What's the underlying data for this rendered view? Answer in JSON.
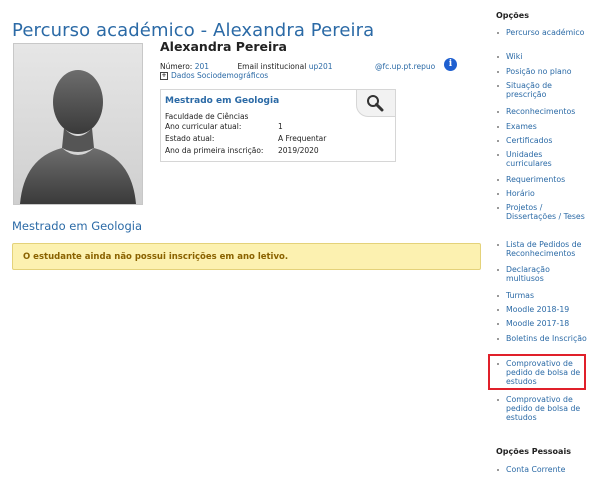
{
  "header": {
    "title": "Percurso académico - Alexandra Pereira"
  },
  "student": {
    "name": "Alexandra Pereira",
    "number_label": "Número:",
    "number_value": "201",
    "email_label": "Email institucional",
    "email_user": "up201",
    "email_domain": "@fc.up.pt.repuo",
    "socio_link": "Dados Sociodemográficos",
    "socio_toggle": "+"
  },
  "course_card": {
    "title": "Mestrado em Geologia",
    "rows": [
      {
        "key": "Faculdade de Ciências",
        "value": ""
      },
      {
        "key": "Ano curricular atual:",
        "value": "1"
      },
      {
        "key": "Estado atual:",
        "value": "A Frequentar"
      },
      {
        "key": "Ano da primeira inscrição:",
        "value": "2019/2020"
      }
    ]
  },
  "section": {
    "title": "Mestrado em Geologia",
    "warning": "O estudante ainda não possui inscrições em ano letivo."
  },
  "sidebar": {
    "options_title": "Opções",
    "items": [
      {
        "label": "Percurso académico"
      },
      {
        "label": "Wiki"
      },
      {
        "label": "Posição no plano"
      },
      {
        "label": "Situação de prescrição"
      },
      {
        "label": "Reconhecimentos"
      },
      {
        "label": "Exames"
      },
      {
        "label": "Certificados"
      },
      {
        "label": "Unidades curriculares"
      },
      {
        "label": "Requerimentos"
      },
      {
        "label": "Horário"
      },
      {
        "label": "Projetos / Dissertações / Teses"
      },
      {
        "label": "Lista de Pedidos de Reconhecimentos"
      },
      {
        "label": "Declaração multiusos"
      },
      {
        "label": "Turmas"
      },
      {
        "label": "Moodle 2018-19"
      },
      {
        "label": "Moodle 2017-18"
      },
      {
        "label": "Boletins de Inscrição"
      },
      {
        "label": "Comprovativo de pedido de bolsa de estudos"
      },
      {
        "label": "Comprovativo de pedido de bolsa de estudos"
      }
    ],
    "personal_title": "Opções Pessoais",
    "personal_items": [
      {
        "label": "Conta Corrente"
      }
    ]
  },
  "colors": {
    "link": "#2b6aa6",
    "warning_bg": "#fcf1b0",
    "warning_text": "#8a6200",
    "highlight": "#e0202a"
  },
  "icons": {
    "info": "info-icon",
    "magnifier": "magnifier-icon",
    "expand": "plus-square-icon",
    "avatar": "person-silhouette"
  }
}
